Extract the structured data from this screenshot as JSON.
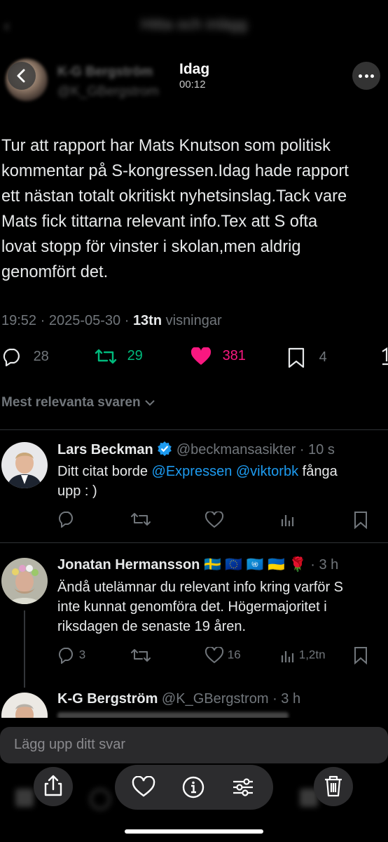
{
  "app": {
    "blurred_title": "Hitta och inlägg",
    "overlay_title": "Idag",
    "overlay_time": "00:12"
  },
  "tweet": {
    "author_name": "K-G Bergström",
    "author_handle": "@K_GBergstrom",
    "text_lines": [
      "Tur att rapport har Mats Knutson som politisk",
      "kommentar på S-kongressen.Idag hade rapport",
      "ett nästan totalt okritiskt nyhetsinslag.Tack vare",
      "Mats fick tittarna relevant info.Tex att S ofta",
      "lovat stopp för vinster i skolan,men aldrig",
      "genomfört det."
    ],
    "time": "19:52",
    "sep1": " · ",
    "date": "2025-05-30",
    "sep2": " · ",
    "views_count": "13tn",
    "views_label": " visningar",
    "stats": {
      "replies": "28",
      "retweets": "29",
      "likes": "381",
      "bookmarks": "4"
    },
    "colors": {
      "retweet": "#00ba7c",
      "like": "#f91880",
      "link": "#1d9bf0"
    }
  },
  "sort_label": "Mest relevanta svaren",
  "replies": [
    {
      "name": "Lars Beckman",
      "handle": "@beckmansasikter",
      "time": "· 10 s",
      "text_prefix": "Ditt citat borde ",
      "mention1": "@Expressen",
      "mention2": "@viktorbk",
      "text_suffix": " fånga",
      "text_line2": "upp : )"
    },
    {
      "name": "Jonatan Hermansson",
      "emoji": "🇸🇪 🇪🇺 🇺🇳 🇺🇦 🌹",
      "time": "· 3 h",
      "text_lines": [
        "Ändå utelämnar du relevant info kring varför S",
        "inte kunnat genomföra det. Högermajoritet i",
        "riksdagen de senaste 19 åren."
      ],
      "replies": "3",
      "likes": "16",
      "views": "1,2tn"
    },
    {
      "name": "K-G Bergström",
      "handle": "@K_GBergstrom",
      "time": "· 3 h"
    }
  ],
  "composer": {
    "placeholder": "Lägg upp ditt svar"
  }
}
